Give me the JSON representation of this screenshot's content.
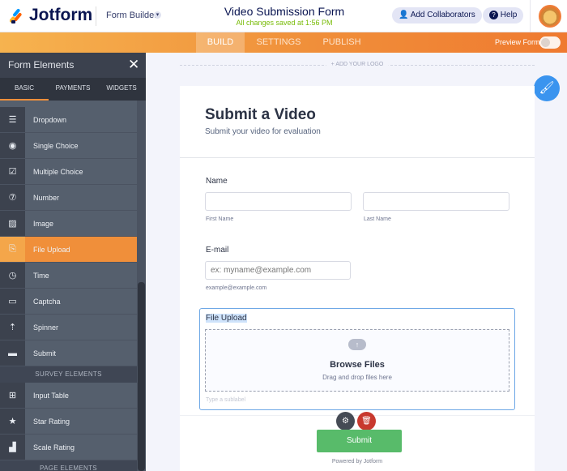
{
  "header": {
    "logo": "Jotform",
    "builder_menu": "Form Builder",
    "form_title": "Video Submission Form",
    "save_status": "All changes saved at 1:56 PM",
    "add_collaborators": "Add Collaborators",
    "help": "Help"
  },
  "nav": {
    "tabs": [
      "BUILD",
      "SETTINGS",
      "PUBLISH"
    ],
    "active": "BUILD",
    "preview_label": "Preview Form",
    "preview_on": false
  },
  "sidebar": {
    "title": "Form Elements",
    "tabs": [
      "BASIC",
      "PAYMENTS",
      "WIDGETS"
    ],
    "active_tab": "BASIC",
    "items": [
      {
        "label": "Dropdown",
        "icon": "dropdown-icon",
        "glyph": "☰"
      },
      {
        "label": "Single Choice",
        "icon": "radio-icon",
        "glyph": "◉"
      },
      {
        "label": "Multiple Choice",
        "icon": "checkbox-icon",
        "glyph": "☑"
      },
      {
        "label": "Number",
        "icon": "number-icon",
        "glyph": "⑦"
      },
      {
        "label": "Image",
        "icon": "image-icon",
        "glyph": "▨"
      },
      {
        "label": "File Upload",
        "icon": "file-upload-icon",
        "glyph": "⎘",
        "selected": true
      },
      {
        "label": "Time",
        "icon": "clock-icon",
        "glyph": "◷"
      },
      {
        "label": "Captcha",
        "icon": "captcha-icon",
        "glyph": "▭"
      },
      {
        "label": "Spinner",
        "icon": "spinner-icon",
        "glyph": "⇡"
      },
      {
        "label": "Submit",
        "icon": "send-icon",
        "glyph": "▬"
      }
    ],
    "survey_header": "SURVEY ELEMENTS",
    "survey_items": [
      {
        "label": "Input Table",
        "icon": "table-icon",
        "glyph": "⊞"
      },
      {
        "label": "Star Rating",
        "icon": "star-icon",
        "glyph": "★"
      },
      {
        "label": "Scale Rating",
        "icon": "bar-chart-icon",
        "glyph": "▟"
      }
    ],
    "page_header": "PAGE ELEMENTS"
  },
  "canvas": {
    "add_logo": "+ ADD YOUR LOGO"
  },
  "form": {
    "heading": "Submit a Video",
    "subheading": "Submit your video for evaluation",
    "name_label": "Name",
    "first_sub": "First Name",
    "last_sub": "Last Name",
    "first_value": "",
    "last_value": "",
    "email_label": "E-mail",
    "email_placeholder": "ex: myname@example.com",
    "email_sub": "example@example.com",
    "upload_label": "File Upload",
    "browse": "Browse Files",
    "drag": "Drag and drop files here",
    "sublabel_placeholder": "Type a sublabel",
    "submit": "Submit",
    "powered": "Powered by Jotform"
  },
  "colors": {
    "accent": "#f08f3a",
    "primary": "#0a1551",
    "submit": "#58bb6a",
    "delete": "#c8392e",
    "selection": "#6ea8e6"
  }
}
